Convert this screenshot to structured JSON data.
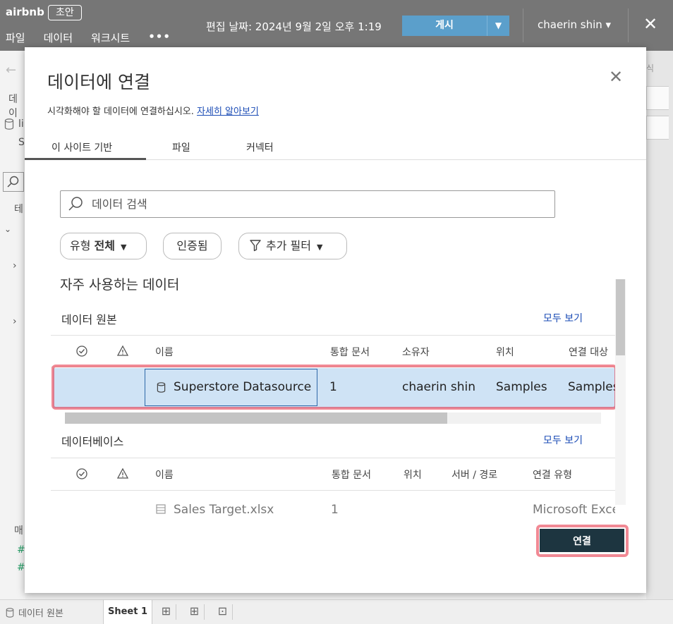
{
  "app": {
    "brand": "airbnb",
    "draft_badge": "초안",
    "menu": [
      "파일",
      "데이터",
      "워크시트"
    ],
    "menu_more": "•••",
    "edit_date": "편집 날짜: 2024년 9월 2일 오후 1:19",
    "publish_label": "게시",
    "user_name": "chaerin shin ▾",
    "close_glyph": "✕"
  },
  "background": {
    "left_fragments": [
      "데이",
      "li",
      "S",
      "테",
      "매"
    ],
    "bottom": {
      "datasource_tab": "데이터 원본",
      "sheet_tab": "Sheet 1"
    }
  },
  "dialog": {
    "title": "데이터에 연결",
    "subtitle": "시각화해야 할 데이터에 연결하십시오.",
    "learn_more": "자세히 알아보기",
    "close_glyph": "✕",
    "tabs": [
      "이 사이트 기반",
      "파일",
      "커넥터"
    ],
    "active_tab": "이 사이트 기반",
    "search_placeholder": "데이터 검색",
    "filters": {
      "type_label": "유형",
      "type_value": "전체",
      "certified": "인증됨",
      "more_filters": "추가 필터"
    },
    "frequent_heading": "자주 사용하는 데이터",
    "datasources": {
      "heading": "데이터 원본",
      "see_all": "모두 보기",
      "columns": [
        "이름",
        "통합 문서",
        "소유자",
        "위치",
        "연결 대상"
      ],
      "rows": [
        {
          "name": "Superstore Datasource",
          "workbooks": "1",
          "owner": "chaerin shin",
          "location": "Samples",
          "connected_to": "Samples"
        }
      ]
    },
    "databases": {
      "heading": "데이터베이스",
      "see_all": "모두 보기",
      "columns": [
        "이름",
        "통합 문서",
        "위치",
        "서버 / 경로",
        "연결 유형"
      ],
      "rows": [
        {
          "name": "Sales Target.xlsx",
          "workbooks": "1",
          "connection_type": "Microsoft Excel"
        }
      ]
    },
    "connect_label": "연결"
  }
}
